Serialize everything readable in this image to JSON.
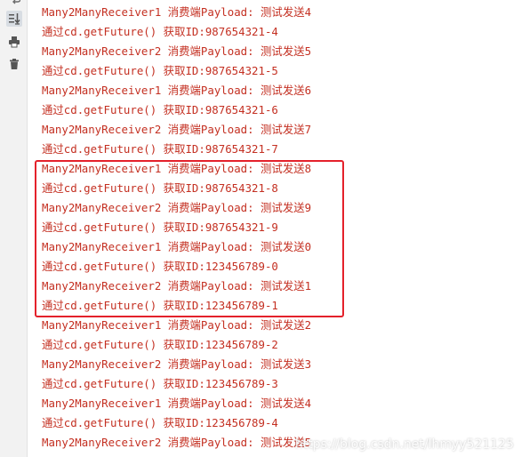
{
  "console": {
    "lines": [
      "Many2ManyReceiver1 消费端Payload: 测试发送4",
      "通过cd.getFuture() 获取ID:987654321-4",
      "Many2ManyReceiver2 消费端Payload: 测试发送5",
      "通过cd.getFuture() 获取ID:987654321-5",
      "Many2ManyReceiver1 消费端Payload: 测试发送6",
      "通过cd.getFuture() 获取ID:987654321-6",
      "Many2ManyReceiver2 消费端Payload: 测试发送7",
      "通过cd.getFuture() 获取ID:987654321-7",
      "Many2ManyReceiver1 消费端Payload: 测试发送8",
      "通过cd.getFuture() 获取ID:987654321-8",
      "Many2ManyReceiver2 消费端Payload: 测试发送9",
      "通过cd.getFuture() 获取ID:987654321-9",
      "Many2ManyReceiver1 消费端Payload: 测试发送0",
      "通过cd.getFuture() 获取ID:123456789-0",
      "Many2ManyReceiver2 消费端Payload: 测试发送1",
      "通过cd.getFuture() 获取ID:123456789-1",
      "Many2ManyReceiver1 消费端Payload: 测试发送2",
      "通过cd.getFuture() 获取ID:123456789-2",
      "Many2ManyReceiver2 消费端Payload: 测试发送3",
      "通过cd.getFuture() 获取ID:123456789-3",
      "Many2ManyReceiver1 消费端Payload: 测试发送4",
      "通过cd.getFuture() 获取ID:123456789-4",
      "Many2ManyReceiver2 消费端Payload: 测试发送5"
    ]
  },
  "toolbar": {
    "icons": [
      "wrap-icon",
      "scroll-to-end-icon",
      "print-icon",
      "trash-icon"
    ]
  },
  "watermark": {
    "text": "https://blog.csdn.net/lhmyy521125"
  },
  "colors": {
    "console_text": "#c43022",
    "highlight_border": "#e4212b",
    "gutter_bg": "#f2f2f2"
  }
}
